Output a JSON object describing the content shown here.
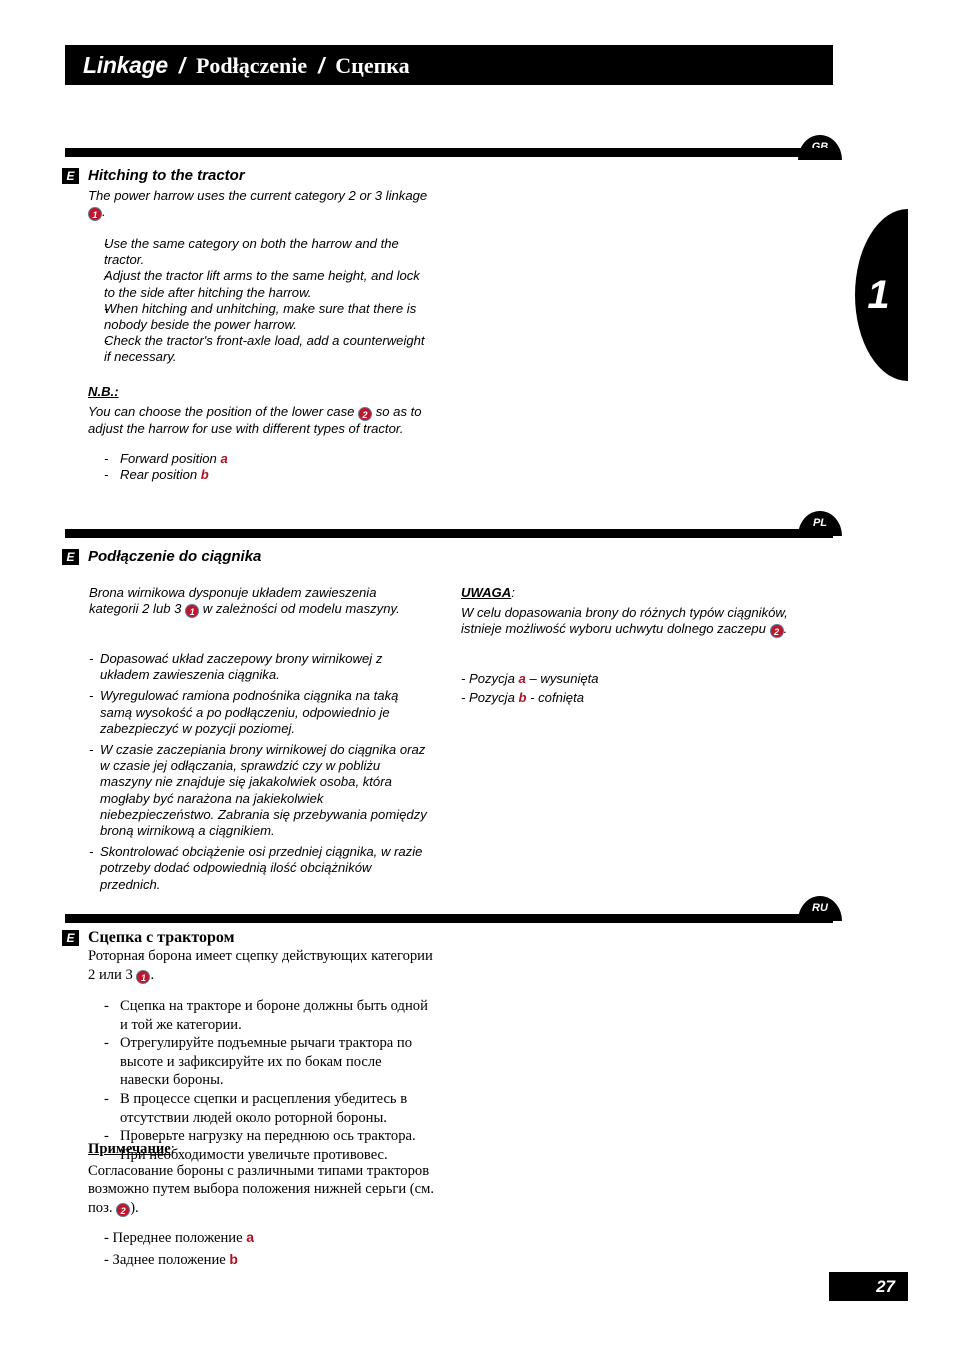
{
  "header": {
    "title_en": "Linkage",
    "sep": "/",
    "title_pl": "Podłączenie",
    "title_ru": "Сцепка"
  },
  "chapter_tab": {
    "number": "1"
  },
  "badges": {
    "e": "E",
    "gb": "GB",
    "pl": "PL",
    "ru": "RU"
  },
  "markers": {
    "one": "1",
    "two": "2"
  },
  "sections": {
    "en": {
      "lang": "GB",
      "heading": "Hitching to the tractor",
      "intro_a": "The power harrow uses the current category 2 or 3",
      "intro_b": "linkage",
      "intro_tail": ".",
      "bullets": [
        "Use the same category on both the harrow and the tractor.",
        "Adjust the tractor lift arms to the same height, and lock to the side after hitching the harrow.",
        "When hitching and unhitching, make sure that there is nobody beside the power harrow.",
        "Check the tractor's front-axle load, add a counterweight if necessary."
      ],
      "nb_label": "N.B.",
      "nb_colon": ":",
      "nb_text_a": "You can choose the position of the lower case",
      "nb_text_b": "so as to adjust the harrow for use with different types of tractor.",
      "positions": [
        {
          "prefix": "Forward position",
          "letter": "a"
        },
        {
          "prefix": "Rear position",
          "letter": "b"
        }
      ]
    },
    "pl": {
      "lang": "PL",
      "heading": "Podłączenie do ciągnika",
      "intro_a": "Brona wirnikowa dysponuje układem zawieszenia kategorii 2 lub 3",
      "intro_b": "w zależności od modelu maszyny.",
      "bullets": [
        "Dopasować układ zaczepowy brony wirnikowej z układem zawieszenia ciągnika.",
        "Wyregulować ramiona podnośnika ciągnika na taką samą wysokość a po podłączeniu, odpowiednio je zabezpieczyć w pozycji poziomej.",
        "W czasie zaczepiania brony wirnikowej do ciągnika oraz w czasie jej odłączania, sprawdzić czy w pobliżu maszyny nie znajduje się jakakolwiek osoba, która mogłaby być narażona na jakiekolwiek niebezpieczeństwo. Zabrania się przebywania pomiędzy broną wirnikową a ciągnikiem.",
        "Skontrolować obciążenie osi przedniej ciągnika, w razie potrzeby dodać odpowiednią ilość obciążników przednich."
      ],
      "note_label": "UWAGA",
      "note_colon": ":",
      "note_text_a": "W celu dopasowania brony do różnych typów ciągników, istnieje możliwość wyboru uchwytu dolnego zaczepu",
      "note_tail": ".",
      "positions": [
        {
          "prefix": "- Pozycja",
          "letter": "a",
          "suffix": "– wysunięta"
        },
        {
          "prefix": "- Pozycja",
          "letter": "b",
          "suffix": "- cofnięta"
        }
      ]
    },
    "ru": {
      "lang": "RU",
      "heading": "Сцепка с трактором",
      "intro_a": "Роторная борона имеет сцепку действующих категории 2 или 3",
      "intro_tail": ".",
      "bullets": [
        "Сцепка на тракторе и бороне должны быть одной и той же категории.",
        "Отрегулируйте подъемные рычаги трактора по высоте и зафиксируйте их по бокам после навески бороны.",
        "В процессе сцепки и расцепления убедитесь в отсутствии людей около роторной бороны.",
        "Проверьте нагрузку на переднюю ось трактора. При необходимости увеличьте противовес."
      ],
      "note_label": "Примечание",
      "note_colon": ":",
      "note_text_a": "Согласование бороны с различными типами тракторов возможно путем выбора положения нижней серьги (см. поз.",
      "note_tail": ").",
      "positions": [
        {
          "prefix": "- Переднее положение",
          "letter": "a"
        },
        {
          "prefix": "- Заднее положение",
          "letter": "b"
        }
      ]
    }
  },
  "footer": {
    "page_number": "27"
  }
}
